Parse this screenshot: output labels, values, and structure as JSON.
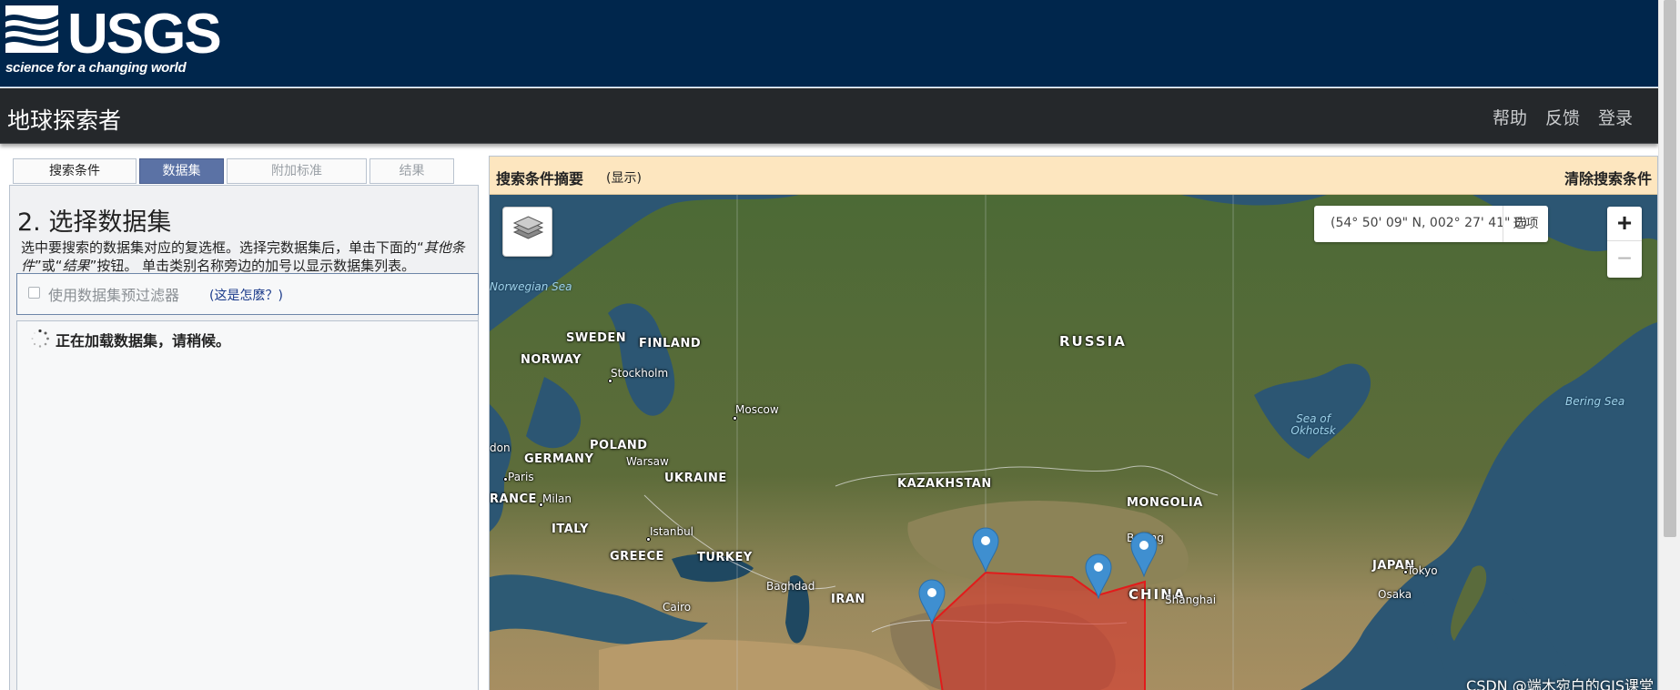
{
  "usgs": {
    "logo_text": "USGS",
    "tagline": "science for a changing world"
  },
  "app": {
    "title": "地球探索者",
    "nav": [
      "帮助",
      "反馈",
      "登录"
    ]
  },
  "tabs": [
    "搜索条件",
    "数据集",
    "附加标准",
    "结果"
  ],
  "active_tab": "数据集",
  "datasets": {
    "step_title": "2. 选择数据集",
    "desc_part1": "选中要搜索的数据集对应的复选框。选择完数据集后，单击下面的“",
    "desc_other": "其他条件",
    "desc_or": "”或“",
    "desc_results": "结果",
    "desc_part2": "”按钮。 单击类别名称旁边的加号以显示数据集列表。",
    "prefilter_label": "使用数据集预过滤器",
    "prefilter_link": "(这是怎麽？)",
    "prefilter_checked": false,
    "loading_text": "正在加载数据集，请稍候。"
  },
  "summary": {
    "title": "搜索条件摘要",
    "show": "(显示)",
    "clear": "清除搜索条件"
  },
  "map": {
    "coordinates": "(54° 50' 09\" N,   002° 27' 41\" E)",
    "options": "选项",
    "zoom_in": "+",
    "zoom_out": "−",
    "countries": [
      "SWEDEN",
      "FINLAND",
      "NORWAY",
      "RUSSIA",
      "POLAND",
      "GERMANY",
      "UKRAINE",
      "RANCE",
      "ITALY",
      "GREECE",
      "TURKEY",
      "KAZAKHSTAN",
      "MONGOLIA",
      "CHINA",
      "IRAN",
      "JAPAN"
    ],
    "cities": [
      "Stockholm",
      "Moscow",
      "Warsaw",
      "Paris",
      "Milan",
      "Istanbul",
      "Baghdad",
      "Cairo",
      "Shanghai",
      "Tokyo",
      "Osaka",
      "don",
      "Beijing"
    ],
    "seas": [
      "Norwegian Sea",
      "Sea of Okhotsk",
      "Bering Sea"
    ],
    "watermark": "CSDN @端木宛白的GIS课堂",
    "colors": {
      "pin": "#3f8fd0",
      "polygon_fill": "#d9342b",
      "polygon_stroke": "#e21b1b"
    }
  }
}
